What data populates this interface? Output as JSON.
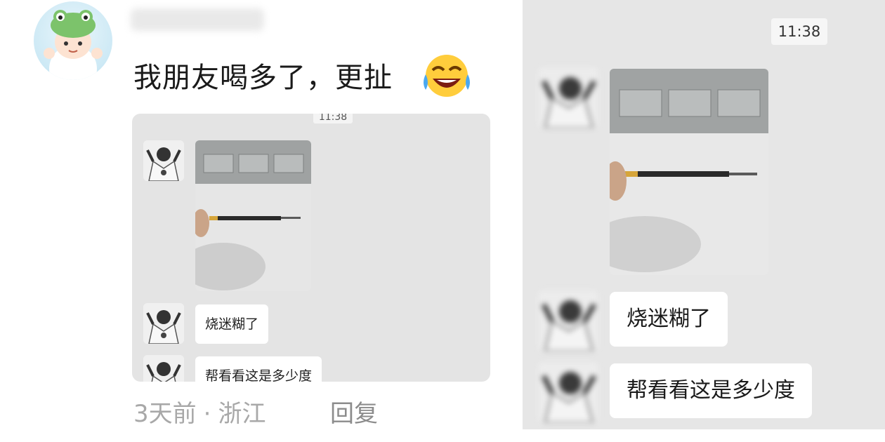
{
  "comment": {
    "text": "我朋友喝多了，更扯",
    "emoji": "laughing-crying-emoji",
    "meta": {
      "time": "3天前",
      "separator": "·",
      "location": "浙江"
    },
    "reply_label": "回复"
  },
  "embedded_chat": {
    "time": "11:38",
    "messages": [
      "烧迷糊了",
      "帮看看这是多少度"
    ]
  },
  "zoomed_chat": {
    "time": "11:38",
    "messages": [
      "烧迷糊了",
      "帮看看这是多少度"
    ]
  },
  "colors": {
    "page_bg": "#ffffff",
    "chat_bg": "#e6e6e6",
    "bubble_bg": "#ffffff",
    "meta_text": "#a8a8a8"
  }
}
